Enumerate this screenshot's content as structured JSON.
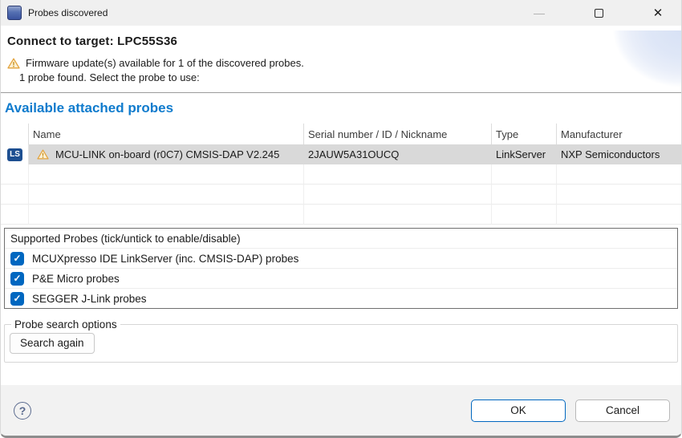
{
  "window": {
    "title": "Probes discovered",
    "controls": {
      "minimize": "—",
      "close": "✕"
    }
  },
  "header": {
    "title": "Connect to target: LPC55S36",
    "warning": "Firmware update(s) available for 1 of the discovered probes.",
    "status": "1 probe found. Select the probe to use:"
  },
  "probes_section": {
    "heading": "Available attached probes",
    "table": {
      "columns": [
        "Name",
        "Serial number / ID / Nickname",
        "Type",
        "Manufacturer"
      ],
      "rows": [
        {
          "badge": "LS",
          "name": "MCU-LINK on-board (r0C7) CMSIS-DAP V2.245",
          "serial": "2JAUW5A31OUCQ",
          "type": "LinkServer",
          "manufacturer": "NXP Semiconductors"
        }
      ]
    }
  },
  "supported_probes": {
    "label": "Supported Probes (tick/untick to enable/disable)",
    "options": [
      {
        "label": "MCUXpresso IDE LinkServer (inc. CMSIS-DAP) probes",
        "checked": true
      },
      {
        "label": "P&E Micro probes",
        "checked": true
      },
      {
        "label": "SEGGER J-Link probes",
        "checked": true
      }
    ]
  },
  "search_options": {
    "legend": "Probe search options",
    "button": "Search again"
  },
  "footer": {
    "help": "?",
    "ok": "OK",
    "cancel": "Cancel"
  },
  "colors": {
    "accent_blue": "#0067c0",
    "heading_blue": "#0f7bcd",
    "badge_blue": "#1d4f91",
    "selected_row": "#d9d9d9",
    "warning_amber": "#e2a23b"
  }
}
